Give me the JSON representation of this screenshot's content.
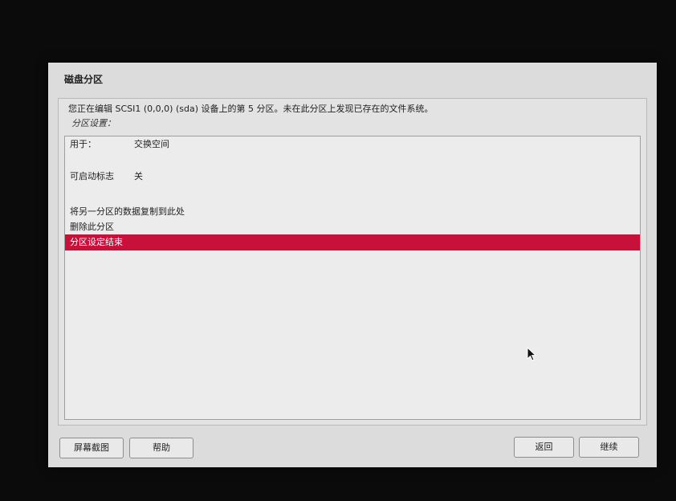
{
  "window": {
    "title": "磁盘分区"
  },
  "info_text": "您正在编辑 SCSI1 (0,0,0) (sda) 设备上的第 5 分区。未在此分区上发现已存在的文件系统。",
  "section_label": "分区设置：",
  "settings": {
    "use_as": {
      "label": "用于：",
      "value": "交换空间"
    },
    "bootable": {
      "label": "可启动标志",
      "value": "关"
    },
    "copy_data": "将另一分区的数据复制到此处",
    "delete": "删除此分区",
    "done": "分区设定结束"
  },
  "buttons": {
    "screenshot": "屏幕截图",
    "help": "帮助",
    "back": "返回",
    "continue": "继续"
  },
  "colors": {
    "selection": "#c7103a"
  }
}
